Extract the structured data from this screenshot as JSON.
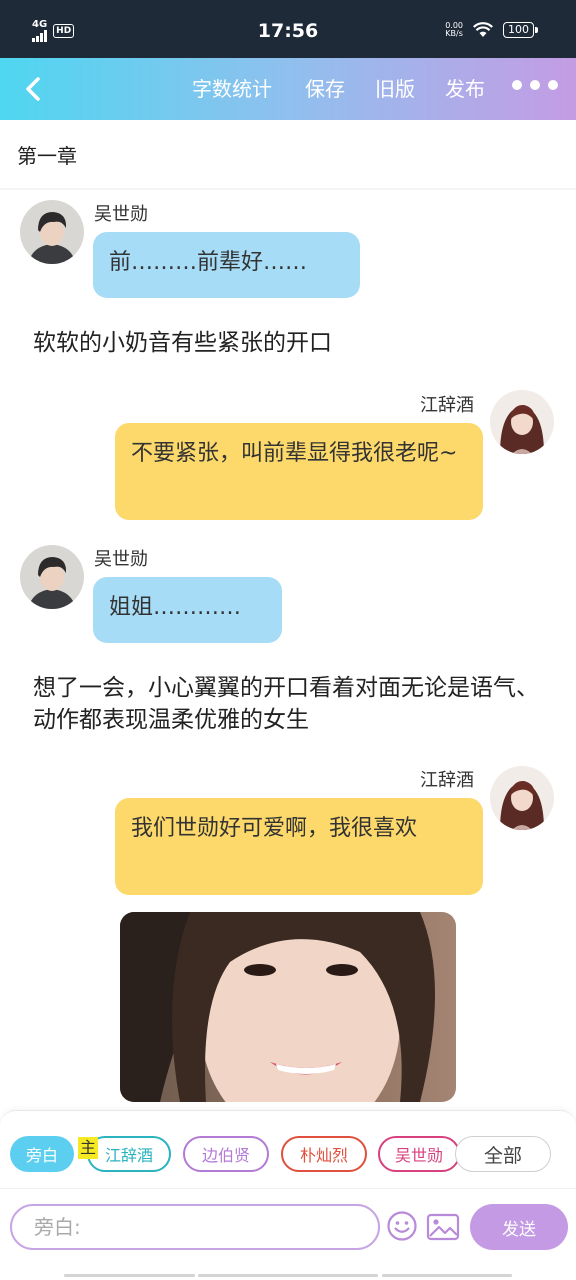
{
  "status_bar": {
    "network": "4G",
    "hd": "HD",
    "time": "17:56",
    "speed_value": "0.00",
    "speed_unit": "KB/s",
    "battery": "100"
  },
  "toolbar": {
    "back_icon": "chevron-left-icon",
    "word_count": "字数统计",
    "save": "保存",
    "old_version": "旧版",
    "publish": "发布",
    "more_icon": "more-dots-icon"
  },
  "chapter_title": "第一章",
  "messages": [
    {
      "type": "left",
      "name": "吴世勋",
      "text": "前………前辈好……"
    },
    {
      "type": "narration",
      "text": "软软的小奶音有些紧张的开口"
    },
    {
      "type": "right",
      "name": "江辞酒",
      "text": "不要紧张，叫前辈显得我很老呢~"
    },
    {
      "type": "left",
      "name": "吴世勋",
      "text": "姐姐…………"
    },
    {
      "type": "narration",
      "text": "想了一会，小心翼翼的开口看着对面无论是语气、动作都表现温柔优雅的女生"
    },
    {
      "type": "right",
      "name": "江辞酒",
      "text": "我们世勋好可爱啊，我很喜欢"
    }
  ],
  "roles": {
    "narrator": "旁白",
    "main_tag": "主",
    "items": [
      "江辞酒",
      "边伯贤",
      "朴灿烈",
      "吴世勋"
    ],
    "all": "全部"
  },
  "colors": {
    "accent_cyan": "#5ccff0",
    "accent_purple": "#c49ae4",
    "left_bubble": "#a6dcf6",
    "right_bubble": "#fcd96a",
    "chip_jiang": "#2bb3c0",
    "chip_bian": "#b37ad6",
    "chip_park": "#e0503c",
    "chip_wu": "#d9407e"
  },
  "composer": {
    "placeholder": "旁白:",
    "emoji_icon": "emoji-smile-icon",
    "image_icon": "image-icon",
    "send": "发送"
  }
}
